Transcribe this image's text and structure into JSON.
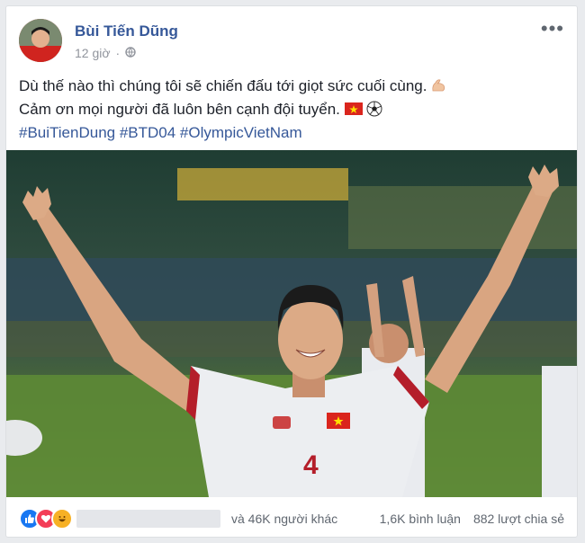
{
  "post": {
    "author": "Bùi Tiến Dũng",
    "time": "12 giờ",
    "more": "•••",
    "lines": [
      "Dù thế nào thì chúng tôi sẽ chiến đấu tới giọt sức cuối cùng.",
      "Cảm ơn mọi người đã luôn bên cạnh đội tuyển."
    ],
    "hashtags": "#BuiTienDung #BTD04 #OlympicVietNam",
    "jersey_number": "4",
    "icons": [
      "muscle-emoji",
      "vietnam-flag",
      "soccer-ball",
      "globe-icon"
    ]
  },
  "footer": {
    "reactions": [
      "like",
      "love",
      "haha"
    ],
    "others": "và 46K người khác",
    "comments": "1,6K bình luận",
    "shares": "882 lượt chia sẻ"
  },
  "colors": {
    "link": "#365899",
    "meta": "#90949c",
    "like": "#1877f2",
    "love": "#f33e58",
    "haha": "#f7b125"
  }
}
